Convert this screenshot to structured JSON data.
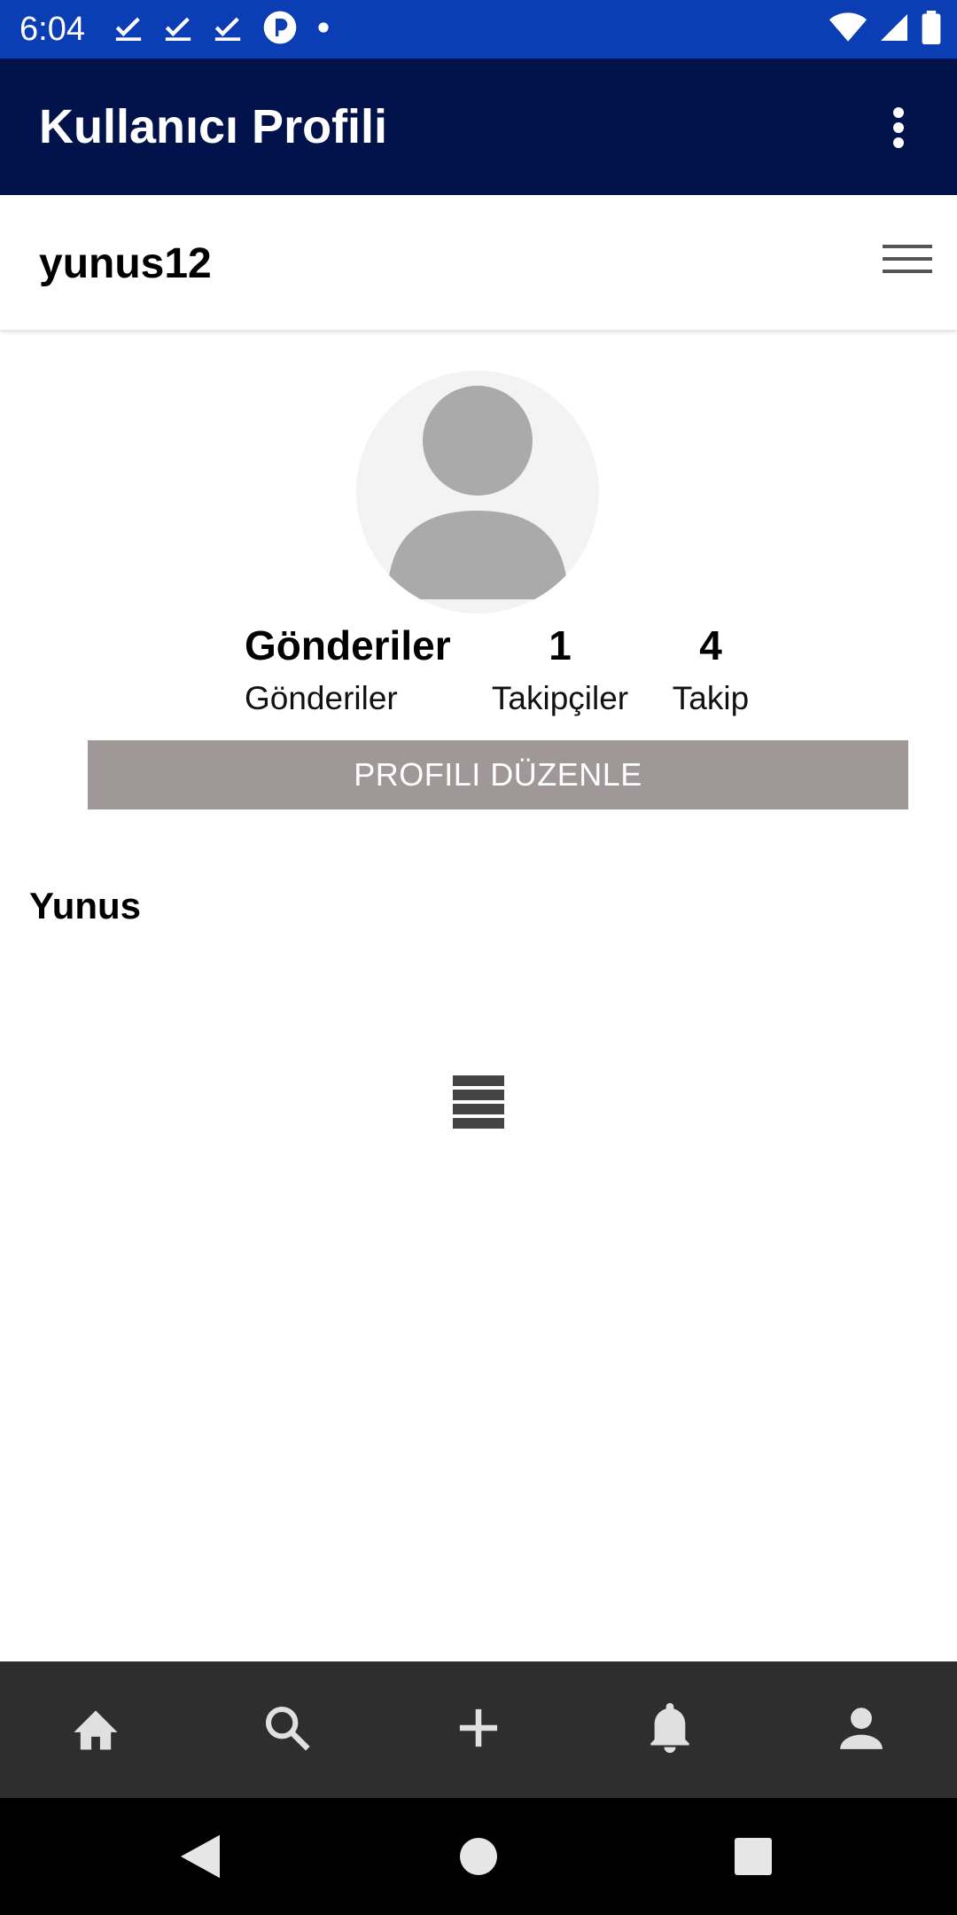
{
  "status_bar": {
    "time": "6:04",
    "icons": [
      "check-icon",
      "check-icon",
      "check-icon",
      "circle-app-icon",
      "dot-icon",
      "wifi-icon",
      "signal-icon",
      "battery-icon"
    ]
  },
  "app_bar": {
    "title": "Kullanıcı Profili",
    "overflow_icon": "more-vert-icon"
  },
  "profile": {
    "username": "yunus12",
    "display_name": "Yunus",
    "stats": [
      {
        "value": "Gönderiler",
        "label": "Gönderiler"
      },
      {
        "value": "1",
        "label": "Takipçiler"
      },
      {
        "value": "4",
        "label": "Takip"
      }
    ],
    "edit_button_label": "PROFILI DÜZENLE"
  },
  "bottom_nav": {
    "items": [
      "home-icon",
      "search-icon",
      "add-icon",
      "notifications-icon",
      "person-icon"
    ]
  },
  "system_nav": {
    "items": [
      "back-icon",
      "home-circle-icon",
      "recents-icon"
    ]
  },
  "colors": {
    "status_bar": "#0b3eb5",
    "app_bar": "#02124a",
    "edit_button": "#a09898",
    "bottom_nav": "#2e2e2e"
  }
}
